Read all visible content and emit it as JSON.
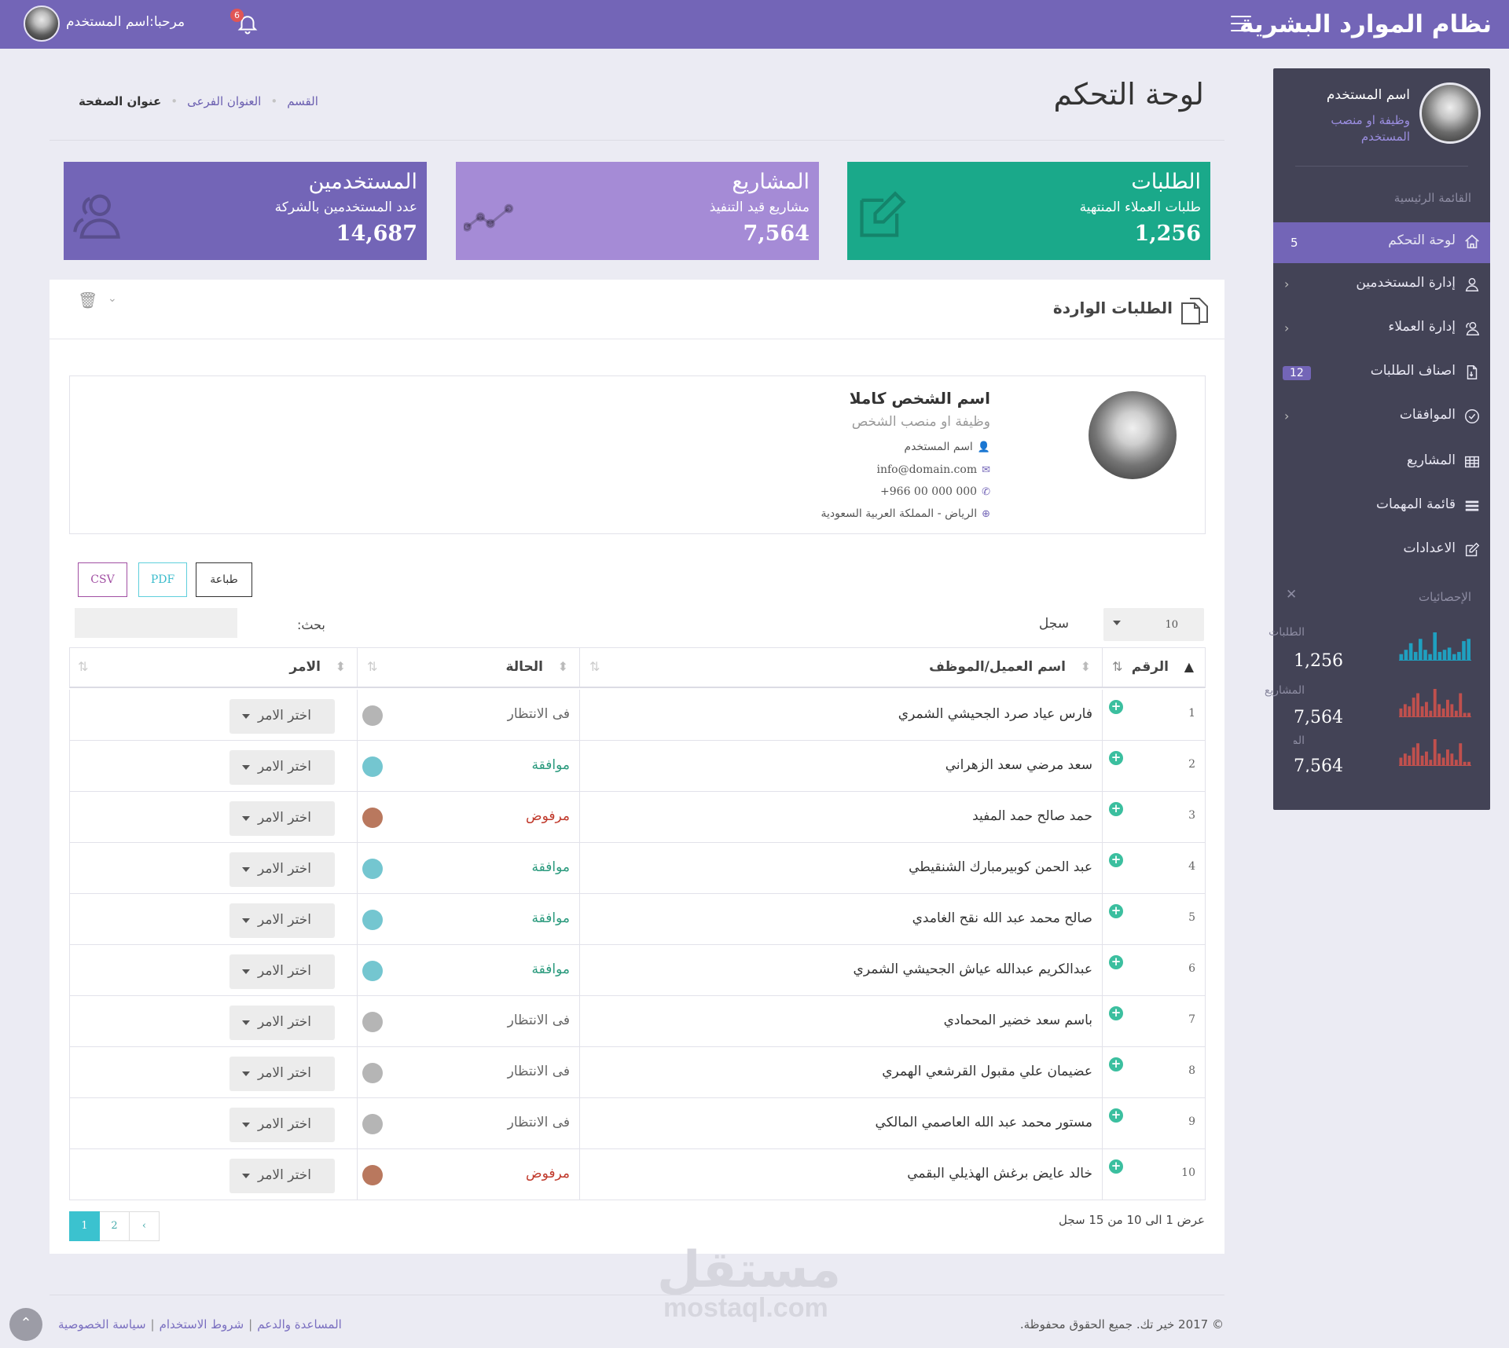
{
  "topbar": {
    "brand": "نظام الموارد البشرية",
    "welcome": "مرحبا:اسم المستخدم",
    "notifications_count": "6"
  },
  "sidebar": {
    "user_name": "اسم المستخدم",
    "user_job": "وظيفة او منصب المستخدم",
    "main_menu_label": "القائمة الرئيسية",
    "items": [
      {
        "label": "لوحة التحكم",
        "icon": "home-icon",
        "count": "5",
        "active": true
      },
      {
        "label": "إدارة المستخدمين",
        "icon": "user-icon"
      },
      {
        "label": "إدارة العملاء",
        "icon": "users-icon"
      },
      {
        "label": "اصناف الطلبات",
        "icon": "file-icon",
        "badge": "12"
      },
      {
        "label": "الموافقات",
        "icon": "check-circle-icon"
      },
      {
        "label": "المشاريع",
        "icon": "table-icon"
      },
      {
        "label": "قائمة المهمات",
        "icon": "list-icon"
      },
      {
        "label": "الاعدادات",
        "icon": "edit-icon"
      }
    ],
    "stats_label": "الإحصائيات",
    "stats": [
      {
        "label": "الطلبات",
        "value": "1,256",
        "color": "#1fa0c0",
        "bars": [
          3,
          5,
          8,
          4,
          10,
          5,
          3,
          13,
          4,
          5,
          6,
          3,
          4,
          9,
          10
        ]
      },
      {
        "label": "المشاريع",
        "value": "7,564",
        "color": "#c0504d",
        "bars": [
          4,
          6,
          5,
          9,
          11,
          5,
          7,
          3,
          13,
          6,
          4,
          8,
          6,
          3,
          11,
          2,
          2
        ]
      },
      {
        "label": "المشاريع",
        "value": "7,564",
        "color": "#c0504d",
        "bars": [
          4,
          6,
          5,
          9,
          11,
          5,
          7,
          3,
          13,
          6,
          4,
          8,
          6,
          3,
          11,
          2,
          2
        ]
      }
    ]
  },
  "header": {
    "title": "لوحة التحكم",
    "breadcrumb": [
      "القسم",
      "العنوان الفرعى",
      "عنوان الصفحة"
    ]
  },
  "cards": {
    "requests": {
      "title": "الطلبات",
      "subtitle": "طلبات العملاء المنتهية",
      "value": "1,256",
      "icon": "edit-icon",
      "color": "#1aa98a"
    },
    "projects": {
      "title": "المشاريع",
      "subtitle": "مشاريع قيد التنفيذ",
      "value": "7,564",
      "icon": "line-chart-icon",
      "color": "#a58bd6"
    },
    "users": {
      "title": "المستخدمين",
      "subtitle": "عدد المستخدمين بالشركة",
      "value": "14,687",
      "icon": "users-icon",
      "color": "#7365b7"
    }
  },
  "panel": {
    "title": "الطلبات الواردة",
    "profile": {
      "name": "اسم الشخص كاملا",
      "job": "وظيفة او منصب الشخص",
      "username": "اسم المستخدم",
      "email": "info@domain.com",
      "phone": "+966 00 000 000",
      "location": "الرياض - المملكة العربية السعودية"
    },
    "export": {
      "print": "طباعة",
      "pdf": "PDF",
      "csv": "CSV"
    },
    "search_label": "بحث:",
    "length_label": "سجل",
    "length_value": "10",
    "columns": {
      "num": "الرقم",
      "name": "اسم العميل/الموظف",
      "status": "الحالة",
      "command": "الامر"
    },
    "command_label": "اختر الامر",
    "rows": [
      {
        "num": "1",
        "name": "فارس عياد صرد الجحيشي الشمري",
        "status": "فى الانتظار",
        "status_type": "pending"
      },
      {
        "num": "2",
        "name": "سعد مرضي سعد الزهراني",
        "status": "موافقة",
        "status_type": "approved"
      },
      {
        "num": "3",
        "name": "حمد صالح حمد المفيد",
        "status": "مرفوض",
        "status_type": "rejected"
      },
      {
        "num": "4",
        "name": "عبد الحمن كوبيرمبارك الشنقيطي",
        "status": "موافقة",
        "status_type": "approved"
      },
      {
        "num": "5",
        "name": "صالح محمد عبد الله نقح الغامدي",
        "status": "موافقة",
        "status_type": "approved"
      },
      {
        "num": "6",
        "name": "عبدالكريم عبدالله عياش الجحيشي الشمري",
        "status": "موافقة",
        "status_type": "approved"
      },
      {
        "num": "7",
        "name": "باسم سعد خضير المحمادي",
        "status": "فى الانتظار",
        "status_type": "pending"
      },
      {
        "num": "8",
        "name": "عضيمان علي مقبول القرشعي الهمري",
        "status": "فى الانتظار",
        "status_type": "pending"
      },
      {
        "num": "9",
        "name": "مستور محمد عبد الله العاصمي المالكي",
        "status": "فى الانتظار",
        "status_type": "pending"
      },
      {
        "num": "10",
        "name": "خالد عايض برغش الهذيلي البقمي",
        "status": "مرفوض",
        "status_type": "rejected"
      }
    ],
    "status_colors": {
      "pending": {
        "text": "#666666",
        "dot": "#b5b5b5"
      },
      "approved": {
        "text": "#2a9a7d",
        "dot": "#74c6d0"
      },
      "rejected": {
        "text": "#c0392b",
        "dot": "#b9785e"
      }
    },
    "info": "عرض 1 الى 10 من 15 سجل",
    "pages": [
      "1",
      "2",
      "›"
    ],
    "active_page": "1"
  },
  "watermark": {
    "ar": "مستقل",
    "en": "mostaql.com"
  },
  "footer": {
    "copyright": "© 2017 خير تك. جميع الحقوق محفوظة.",
    "links": [
      "المساعدة والدعم",
      "شروط الاستخدام",
      "سياسة الخصوصية"
    ]
  }
}
